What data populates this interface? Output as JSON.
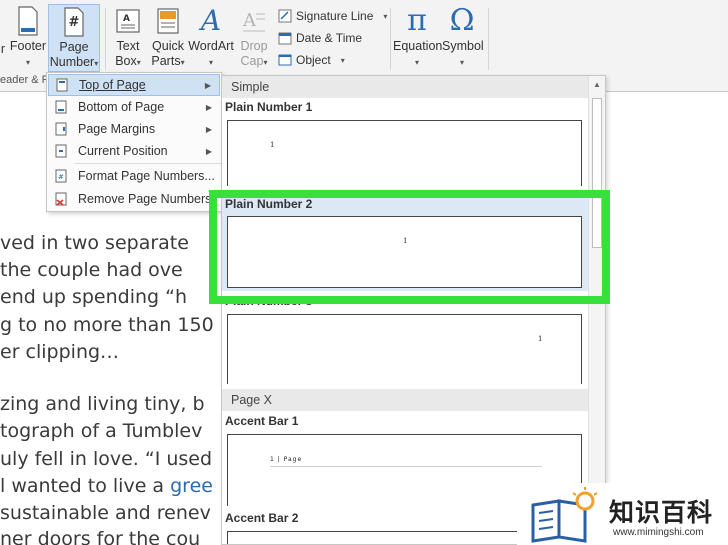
{
  "ribbon": {
    "footer_label": "Footer",
    "page_number_label_1": "Page",
    "page_number_label_2": "Number",
    "text_box_label_1": "Text",
    "text_box_label_2": "Box",
    "quick_parts_label_1": "Quick",
    "quick_parts_label_2": "Parts",
    "wordart_label": "WordArt",
    "drop_cap_label_1": "Drop",
    "drop_cap_label_2": "Cap",
    "signature_line_label": "Signature Line",
    "date_time_label": "Date & Time",
    "object_label": "Object",
    "equation_label": "Equation",
    "symbol_label": "Symbol",
    "group_label_partial": "eader & F",
    "footer_cut": "r",
    "equation_glyph": "π",
    "symbol_glyph": "Ω",
    "wordart_glyph": "A"
  },
  "page_number_menu": {
    "items": [
      {
        "label": "Top of Page",
        "icon": "page-top-icon",
        "has_submenu": true,
        "selected": true
      },
      {
        "label": "Bottom of Page",
        "icon": "page-bottom-icon",
        "has_submenu": true
      },
      {
        "label": "Page Margins",
        "icon": "page-margins-icon",
        "has_submenu": true
      },
      {
        "label": "Current Position",
        "icon": "current-position-icon",
        "has_submenu": true
      },
      {
        "label": "Format Page Numbers...",
        "icon": "format-numbers-icon",
        "has_submenu": false
      },
      {
        "label": "Remove Page Numbers",
        "icon": "remove-numbers-icon",
        "has_submenu": false
      }
    ]
  },
  "gallery": {
    "section_simple": "Simple",
    "plain_number_1": "Plain Number 1",
    "plain_number_2": "Plain Number 2",
    "plain_number_3": "Plain Number 3",
    "section_page_x": "Page X",
    "accent_bar_1": "Accent Bar 1",
    "accent_bar_2": "Accent Bar 2",
    "sample_number": "1",
    "accent_sample": "1 | Page"
  },
  "document": {
    "lines": [
      "ved in two separate",
      " the couple had ove",
      " end up spending “h",
      "g to no more than 150",
      "er clipping…",
      "zing and living tiny, b",
      "tograph of a Tumblev",
      "uly fell in love. “I used",
      "l wanted to live a ",
      "sustainable and renev",
      "ner doors for the cou"
    ],
    "link_text": "gree"
  },
  "watermark": {
    "title": "知识百科",
    "url": "www.mimingshi.com"
  },
  "colors": {
    "highlight_green": "#38e03c",
    "selection_blue": "#cfe1f4",
    "link_blue": "#2b6cb0",
    "watermark_blue": "#2a5fa5",
    "watermark_orange": "#f0a12b"
  }
}
